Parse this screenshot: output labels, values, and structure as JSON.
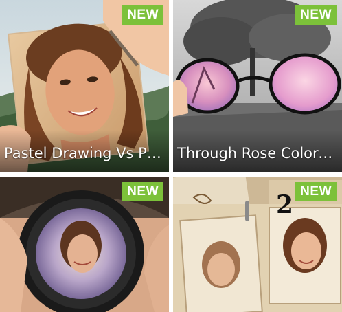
{
  "cards": [
    {
      "title": "Pastel Drawing Vs Ph...",
      "badge": "NEW"
    },
    {
      "title": "Through Rose Colore...",
      "badge": "NEW"
    },
    {
      "title": "",
      "badge": "NEW"
    },
    {
      "title": "",
      "badge": "NEW",
      "overlay_number": "2"
    }
  ],
  "colors": {
    "badge": "#7cc13a",
    "caption_text": "#ffffff",
    "gutter": "#ffffff"
  }
}
